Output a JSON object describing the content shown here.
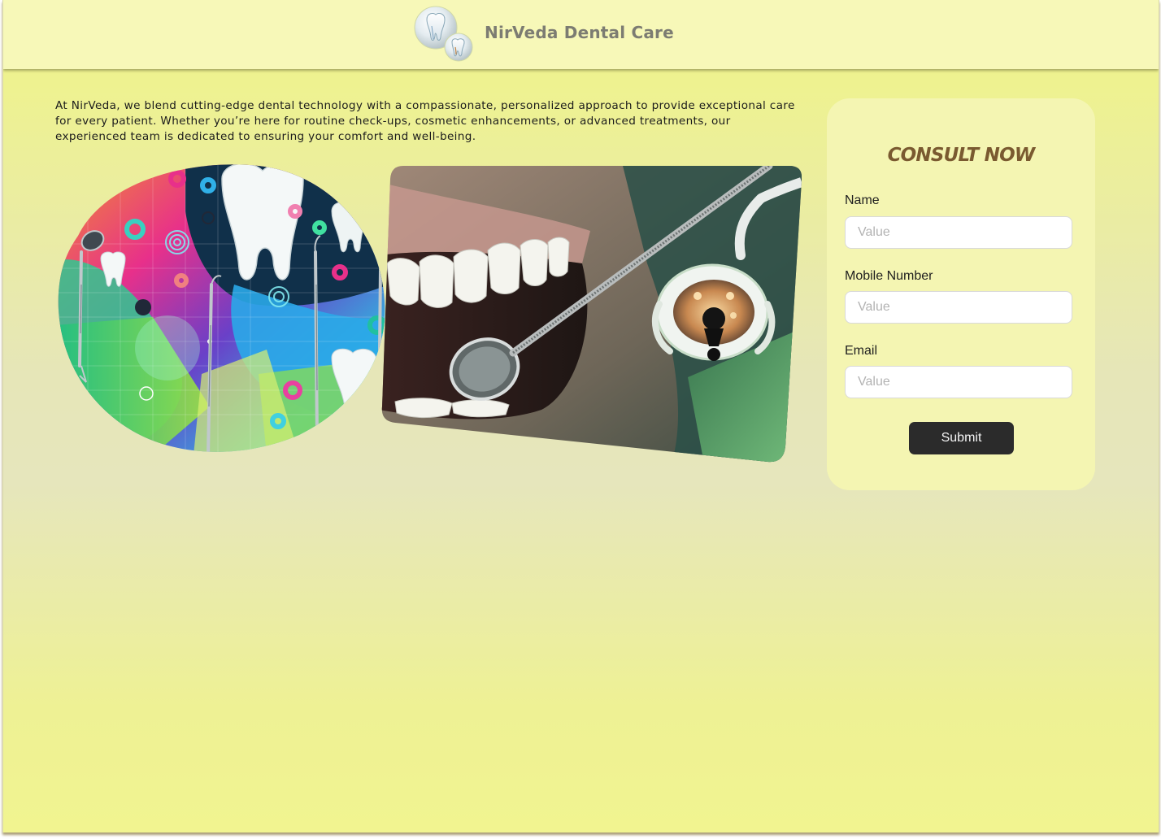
{
  "header": {
    "brand_name": "NirVeda Dental Care",
    "logo_icon": "tooth-logo-icon"
  },
  "intro": {
    "text": "At NirVeda, we blend cutting-edge dental technology with a compassionate, personalized approach to provide exceptional care for every patient. Whether you’re here for routine check-ups, cosmetic enhancements, or advanced treatments, our experienced team is dedicated to ensuring your comfort and well-being."
  },
  "gallery": {
    "left_image_icon": "abstract-teeth-tools-illustration",
    "right_image_icon": "dental-mirror-smile-photo"
  },
  "consult_form": {
    "title": "CONSULT NOW",
    "fields": [
      {
        "label": "Name",
        "placeholder": "Value",
        "value": ""
      },
      {
        "label": "Mobile Number",
        "placeholder": "Value",
        "value": ""
      },
      {
        "label": "Email",
        "placeholder": "Value",
        "value": ""
      }
    ],
    "submit_label": "Submit"
  },
  "colors": {
    "header_bg": "#f7f8b8",
    "brand_text": "#7c7c72",
    "form_title": "#7a5a30",
    "form_card_bg": "#f4f5b2",
    "button_bg": "#2b2b2b"
  }
}
